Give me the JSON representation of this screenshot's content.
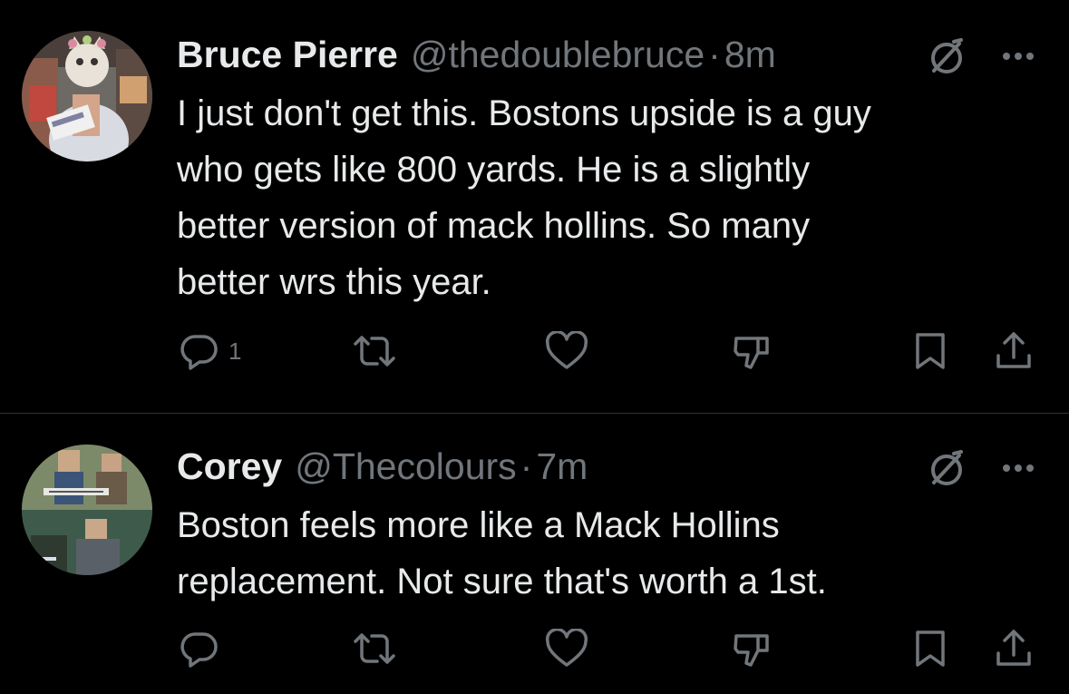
{
  "theme": {
    "background": "#000000",
    "text_primary": "#e7e9ea",
    "text_secondary": "#71767b",
    "divider": "#2f3336"
  },
  "tweets": [
    {
      "display_name": "Bruce Pierre",
      "handle": "@thedoublebruce",
      "separator": "·",
      "time": "8m",
      "body_lines": [
        "I just don't get this. Bostons upside is a guy",
        "who gets like 800 yards. He is a slightly",
        "better version of mack hollins. So many",
        "better wrs this year."
      ],
      "reply_count": "1",
      "icons": [
        "grok-icon",
        "more-icon",
        "reply-icon",
        "retweet-icon",
        "like-icon",
        "dislike-icon",
        "bookmark-icon",
        "share-icon"
      ]
    },
    {
      "display_name": "Corey",
      "handle": "@Thecolours",
      "separator": "·",
      "time": "7m",
      "body_lines": [
        "Boston feels more like a Mack Hollins",
        "replacement.  Not sure that's worth a 1st."
      ],
      "reply_count": "",
      "icons": [
        "grok-icon",
        "more-icon",
        "reply-icon",
        "retweet-icon",
        "like-icon",
        "dislike-icon",
        "bookmark-icon",
        "share-icon"
      ]
    }
  ]
}
